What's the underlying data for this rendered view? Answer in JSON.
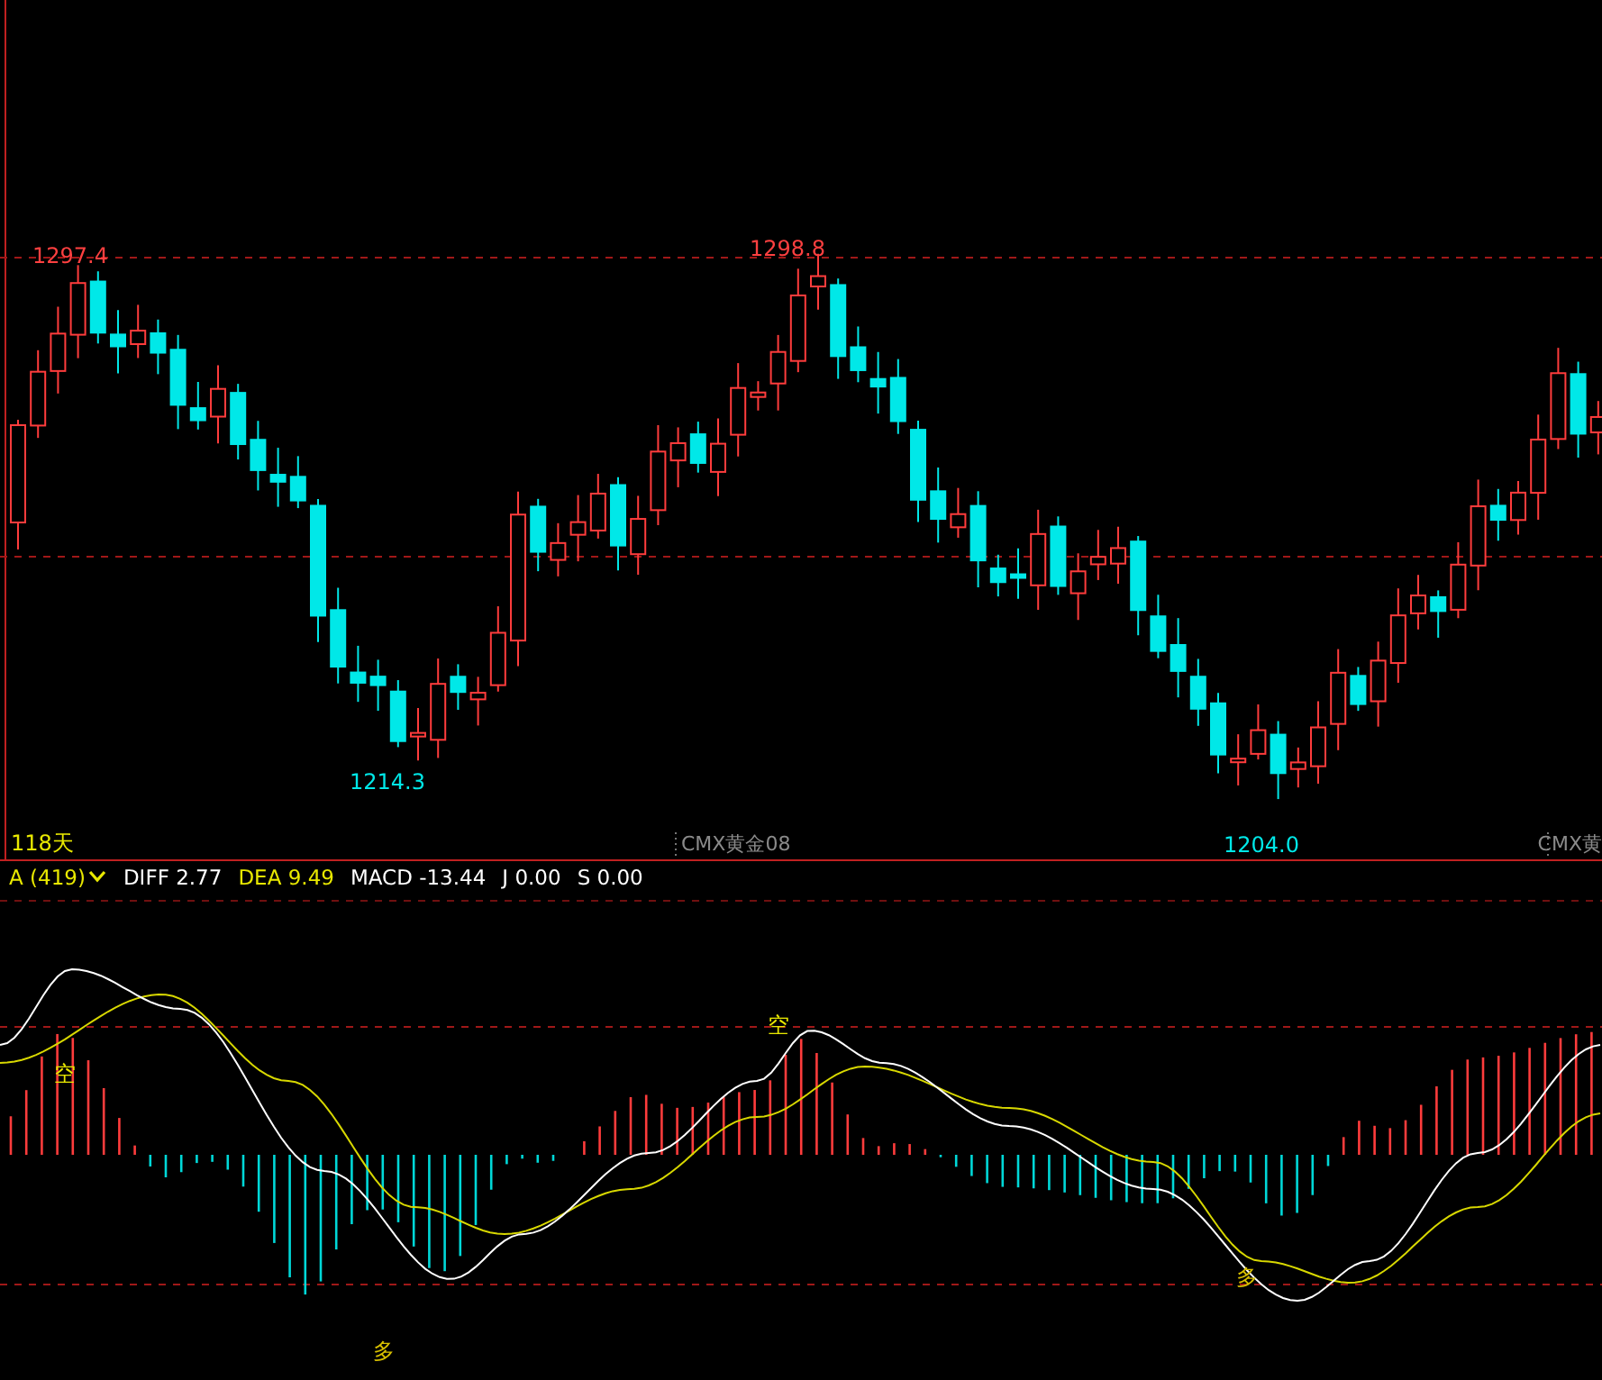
{
  "price_chart": {
    "price_labels": [
      {
        "text": "1297.4",
        "kind": "high"
      },
      {
        "text": "1298.8",
        "kind": "high"
      },
      {
        "text": "1214.3",
        "kind": "low"
      },
      {
        "text": "1204.0",
        "kind": "low"
      }
    ],
    "period": "118天",
    "contract_labels": [
      "CMX黄金08",
      "CMX黄"
    ]
  },
  "indicator_bar": {
    "selector": "A (419)",
    "values": [
      {
        "text": "DIFF 2.77",
        "color": "#ffffff"
      },
      {
        "text": "DEA 9.49",
        "color": "#e8e800"
      },
      {
        "text": "MACD -13.44",
        "color": "#ffffff"
      },
      {
        "text": "J 0.00",
        "color": "#ffffff"
      },
      {
        "text": "S 0.00",
        "color": "#ffffff"
      }
    ]
  },
  "macd_chart": {
    "signals": [
      {
        "text": "空",
        "kind": "sell"
      },
      {
        "text": "空",
        "kind": "sell"
      },
      {
        "text": "多",
        "kind": "buy"
      },
      {
        "text": "多",
        "kind": "buy"
      }
    ]
  }
}
